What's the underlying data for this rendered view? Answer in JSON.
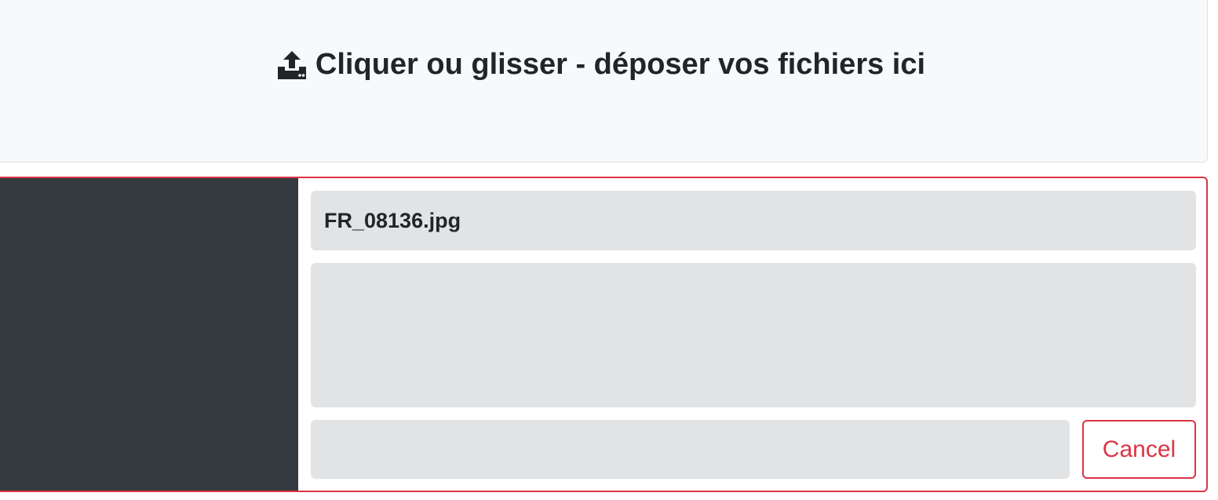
{
  "dropzone": {
    "label": "Cliquer ou glisser - déposer vos fichiers ici",
    "icon": "upload-icon"
  },
  "file": {
    "name": "FR_08136.jpg",
    "cancel_label": "Cancel"
  },
  "colors": {
    "danger": "#dc3545",
    "dark": "#343a40",
    "light_bg": "#f8f9fa",
    "placeholder_gray": "#e2e3e5",
    "text": "#212529"
  }
}
